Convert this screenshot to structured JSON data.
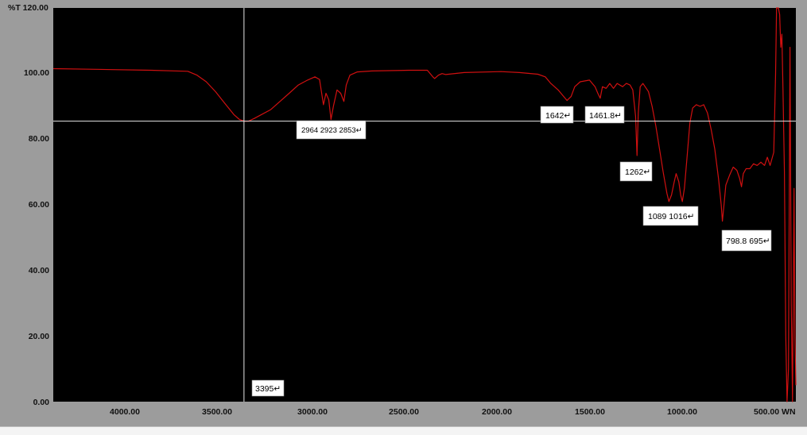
{
  "chart_data": {
    "type": "line",
    "y_corner_label": "%T 120.00",
    "x_corner_label": "500.00 WN",
    "x_axis": {
      "reversed": true,
      "range": [
        4430,
        400
      ],
      "ticks": [
        "4000.00",
        "3500.00",
        "3000.00",
        "2500.00",
        "2000.00",
        "1500.00",
        "1000.00"
      ]
    },
    "y_axis": {
      "range": [
        0,
        120
      ],
      "ticks": [
        "0.00",
        "20.00",
        "40.00",
        "60.00",
        "80.00",
        "100.00"
      ]
    },
    "colors": {
      "plot_background": "#000000",
      "frame": "#9c9c9c",
      "line": "#d01010",
      "cursor": "#e6e6e6"
    },
    "cursor": {
      "x": 3395,
      "y": 85.5
    },
    "series": [
      {
        "points": [
          [
            4430,
            101.5
          ],
          [
            4200,
            101.3
          ],
          [
            3900,
            101.0
          ],
          [
            3700,
            100.7
          ],
          [
            3650,
            99.5
          ],
          [
            3600,
            97.5
          ],
          [
            3550,
            94.5
          ],
          [
            3500,
            91.0
          ],
          [
            3450,
            87.5
          ],
          [
            3420,
            86.0
          ],
          [
            3395,
            85.5
          ],
          [
            3370,
            85.5
          ],
          [
            3340,
            86.3
          ],
          [
            3300,
            87.5
          ],
          [
            3250,
            89.0
          ],
          [
            3200,
            91.5
          ],
          [
            3150,
            94.0
          ],
          [
            3100,
            96.5
          ],
          [
            3050,
            98.0
          ],
          [
            3010,
            99.0
          ],
          [
            2985,
            98.2
          ],
          [
            2964,
            90.5
          ],
          [
            2950,
            94.0
          ],
          [
            2935,
            92.0
          ],
          [
            2923,
            86.0
          ],
          [
            2910,
            90.0
          ],
          [
            2890,
            95.0
          ],
          [
            2870,
            94.0
          ],
          [
            2853,
            91.5
          ],
          [
            2840,
            96.5
          ],
          [
            2820,
            99.5
          ],
          [
            2780,
            100.5
          ],
          [
            2700,
            100.8
          ],
          [
            2500,
            101.0
          ],
          [
            2400,
            101.0
          ],
          [
            2370,
            99.0
          ],
          [
            2360,
            98.5
          ],
          [
            2340,
            99.5
          ],
          [
            2320,
            100.0
          ],
          [
            2300,
            99.7
          ],
          [
            2200,
            100.3
          ],
          [
            2000,
            100.6
          ],
          [
            1900,
            100.3
          ],
          [
            1800,
            99.8
          ],
          [
            1760,
            99.0
          ],
          [
            1730,
            97.0
          ],
          [
            1690,
            95.0
          ],
          [
            1660,
            93.0
          ],
          [
            1642,
            91.8
          ],
          [
            1620,
            93.0
          ],
          [
            1600,
            96.0
          ],
          [
            1570,
            97.5
          ],
          [
            1520,
            98.0
          ],
          [
            1490,
            96.0
          ],
          [
            1475,
            94.0
          ],
          [
            1461.8,
            92.5
          ],
          [
            1450,
            96.0
          ],
          [
            1430,
            95.5
          ],
          [
            1410,
            97.0
          ],
          [
            1390,
            95.5
          ],
          [
            1370,
            97.0
          ],
          [
            1340,
            96.0
          ],
          [
            1320,
            97.0
          ],
          [
            1300,
            96.5
          ],
          [
            1285,
            95.0
          ],
          [
            1270,
            87.0
          ],
          [
            1262,
            75.0
          ],
          [
            1255,
            88.0
          ],
          [
            1245,
            96.0
          ],
          [
            1230,
            97.0
          ],
          [
            1200,
            94.5
          ],
          [
            1180,
            90.0
          ],
          [
            1160,
            84.0
          ],
          [
            1140,
            77.0
          ],
          [
            1120,
            70.0
          ],
          [
            1100,
            63.5
          ],
          [
            1089,
            61.0
          ],
          [
            1075,
            63.0
          ],
          [
            1060,
            67.0
          ],
          [
            1050,
            69.5
          ],
          [
            1035,
            67.0
          ],
          [
            1025,
            63.0
          ],
          [
            1016,
            61.0
          ],
          [
            1005,
            65.0
          ],
          [
            990,
            75.0
          ],
          [
            975,
            85.0
          ],
          [
            960,
            89.5
          ],
          [
            940,
            90.5
          ],
          [
            920,
            90.0
          ],
          [
            900,
            90.5
          ],
          [
            880,
            88.0
          ],
          [
            860,
            83.0
          ],
          [
            840,
            77.0
          ],
          [
            820,
            68.0
          ],
          [
            805,
            60.0
          ],
          [
            798.8,
            55.0
          ],
          [
            790,
            60.0
          ],
          [
            780,
            66.0
          ],
          [
            760,
            69.0
          ],
          [
            740,
            71.5
          ],
          [
            720,
            70.5
          ],
          [
            705,
            68.0
          ],
          [
            695,
            65.5
          ],
          [
            685,
            69.5
          ],
          [
            670,
            71.0
          ],
          [
            650,
            71.0
          ],
          [
            630,
            72.5
          ],
          [
            610,
            72.0
          ],
          [
            590,
            73.0
          ],
          [
            570,
            72.0
          ],
          [
            555,
            74.5
          ],
          [
            540,
            72.0
          ],
          [
            530,
            74.0
          ],
          [
            520,
            76.0
          ],
          [
            510,
            100.0
          ],
          [
            505,
            120.0
          ],
          [
            495,
            120.0
          ],
          [
            488,
            118.0
          ],
          [
            482,
            108.0
          ],
          [
            476,
            112.0
          ],
          [
            470,
            95.0
          ],
          [
            462,
            70.0
          ],
          [
            455,
            20.0
          ],
          [
            448,
            0.0
          ],
          [
            440,
            10.0
          ],
          [
            432,
            108.0
          ],
          [
            425,
            30.0
          ],
          [
            418,
            0.0
          ],
          [
            410,
            65.0
          ],
          [
            405,
            20.0
          ],
          [
            400,
            5.0
          ]
        ]
      }
    ],
    "annotations": [
      {
        "text": "3395↵",
        "wn": 3395
      },
      {
        "text": "2964 2923 2853↵",
        "wn": 2923
      },
      {
        "text": "1642↵",
        "wn": 1642
      },
      {
        "text": "1461.8↵",
        "wn": 1461.8
      },
      {
        "text": "1262↵",
        "wn": 1262
      },
      {
        "text": "1089 1016↵",
        "wn": 1050
      },
      {
        "text": "798.8 695↵",
        "wn": 750
      }
    ]
  }
}
